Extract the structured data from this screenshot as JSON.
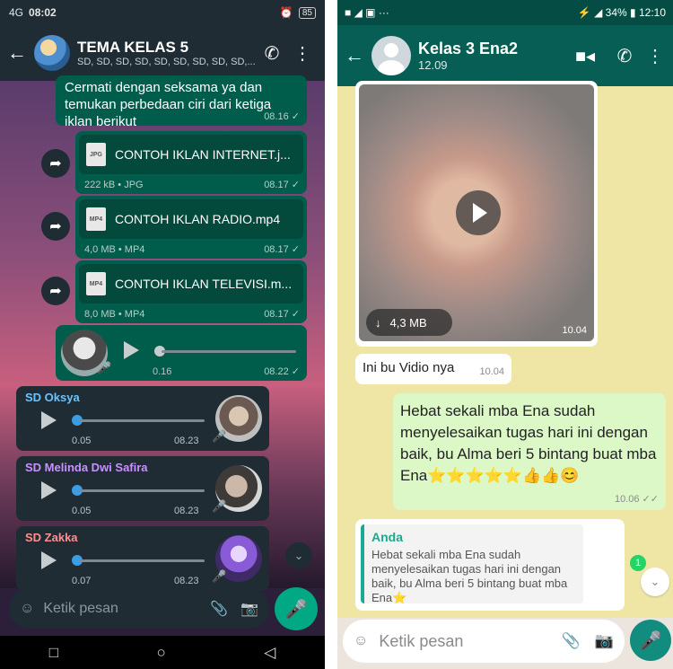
{
  "left": {
    "status": {
      "carrier": "4G",
      "time": "08:02",
      "battery": "85"
    },
    "header": {
      "title": "TEMA KELAS 5",
      "subtitle": "SD, SD, SD, SD, SD, SD, SD, SD, SD,..."
    },
    "messages": {
      "text1": {
        "text": "Cermati dengan seksama ya dan temukan perbedaan ciri dari ketiga iklan berikut",
        "time": "08.16 ✓"
      },
      "file1": {
        "name": "CONTOH IKLAN INTERNET.j...",
        "ext": "JPG",
        "meta": "222 kB • JPG",
        "time": "08.17 ✓"
      },
      "file2": {
        "name": "CONTOH IKLAN RADIO.mp4",
        "ext": "MP4",
        "meta": "4,0 MB • MP4",
        "time": "08.17 ✓"
      },
      "file3": {
        "name": "CONTOH IKLAN TELEVISI.m...",
        "ext": "MP4",
        "meta": "8,0 MB • MP4",
        "time": "08.17 ✓"
      },
      "voice_out": {
        "duration": "0.16",
        "time": "08.22 ✓"
      },
      "voice1": {
        "sender": "SD Oksya",
        "duration": "0.05",
        "time": "08.23"
      },
      "voice2": {
        "sender": "SD Melinda Dwi Safira",
        "duration": "0.05",
        "time": "08.23"
      },
      "voice3": {
        "sender": "SD Zakka",
        "duration": "0.07",
        "time": "08.23"
      }
    },
    "input": {
      "placeholder": "Ketik pesan"
    },
    "colors": {
      "oksya": "#6cc3ff",
      "melinda": "#c891ff",
      "zakka": "#ff8f8f"
    }
  },
  "right": {
    "status": {
      "battery": "34%",
      "time": "12:10"
    },
    "header": {
      "title": "Kelas 3 Ena2",
      "subtitle": "12.09"
    },
    "messages": {
      "video": {
        "size": "4,3 MB",
        "time": "10.04"
      },
      "caption": {
        "text": "Ini bu Vidio nya",
        "time": "10.04"
      },
      "praise": {
        "text": "Hebat sekali mba Ena sudah menyelesaikan tugas hari ini dengan baik, bu Alma beri 5 bintang buat mba Ena⭐⭐⭐⭐⭐👍👍😊",
        "time": "10.06 ✓✓"
      },
      "reply": {
        "name": "Anda",
        "text": "Hebat sekali mba Ena sudah menyelesaikan tugas hari ini dengan baik, bu Alma beri 5 bintang buat mba Ena⭐"
      }
    },
    "unread_badge": "1",
    "input": {
      "placeholder": "Ketik pesan"
    }
  }
}
